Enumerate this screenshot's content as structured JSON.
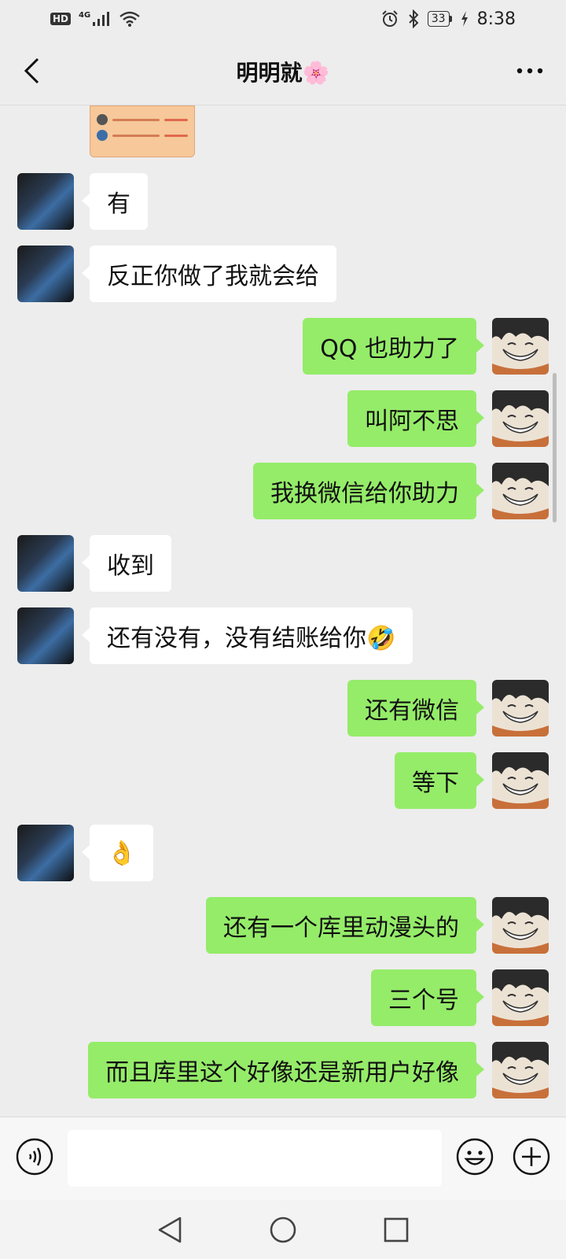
{
  "status_bar": {
    "hd_label": "HD",
    "network_label": "4G",
    "battery_level": "33",
    "time": "8:38"
  },
  "header": {
    "title": "明明就",
    "title_emoji": "🌸"
  },
  "messages": [
    {
      "side": "left",
      "text": "有"
    },
    {
      "side": "left",
      "text": "反正你做了我就会给"
    },
    {
      "side": "right",
      "text": "QQ 也助力了"
    },
    {
      "side": "right",
      "text": "叫阿不思"
    },
    {
      "side": "right",
      "text": "我换微信给你助力"
    },
    {
      "side": "left",
      "text": "收到"
    },
    {
      "side": "left",
      "text": "还有没有，没有结账给你🤣"
    },
    {
      "side": "right",
      "text": "还有微信"
    },
    {
      "side": "right",
      "text": "等下"
    },
    {
      "side": "left",
      "text": "👌"
    },
    {
      "side": "right",
      "text": "还有一个库里动漫头的"
    },
    {
      "side": "right",
      "text": "三个号"
    },
    {
      "side": "right",
      "text": "而且库里这个好像还是新用户好像"
    }
  ],
  "input": {
    "value": "",
    "placeholder": ""
  },
  "colors": {
    "background": "#ededed",
    "self_bubble": "#95ec69",
    "other_bubble": "#ffffff",
    "input_bar": "#f7f7f7"
  },
  "icons": {
    "back": "chevron-left-icon",
    "more": "more-dots-icon",
    "voice": "voice-icon",
    "emoji": "emoji-icon",
    "plus": "plus-icon",
    "nav_back": "nav-back-icon",
    "nav_home": "nav-home-icon",
    "nav_recents": "nav-recents-icon"
  }
}
